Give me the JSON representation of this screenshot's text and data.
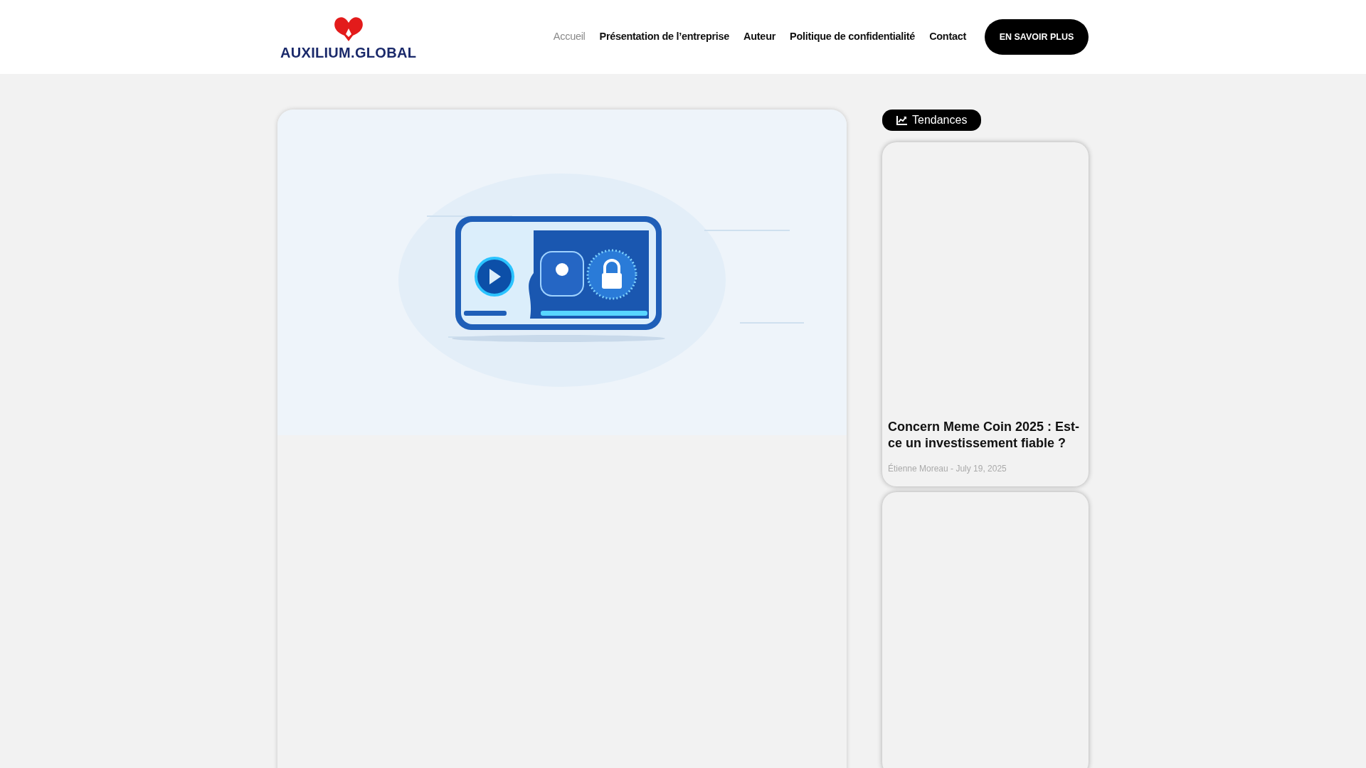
{
  "header": {
    "logo_text": "AUXILIUM.GLOBAL",
    "nav": [
      {
        "label": "Accueil",
        "selected": true
      },
      {
        "label": "Présentation de l’entreprise",
        "selected": false
      },
      {
        "label": "Auteur",
        "selected": false
      },
      {
        "label": "Politique de confidentialité",
        "selected": false
      },
      {
        "label": "Contact",
        "selected": false
      }
    ],
    "cta": "EN SAVOIR PLUS"
  },
  "sidebar": {
    "badge": "Tendances",
    "posts": [
      {
        "kind": "post",
        "title": "Concern Meme Coin 2025 : Est-ce un investissement fiable ?",
        "meta": "Étienne Moreau - July 19, 2025"
      },
      {
        "kind": "blank"
      }
    ]
  }
}
